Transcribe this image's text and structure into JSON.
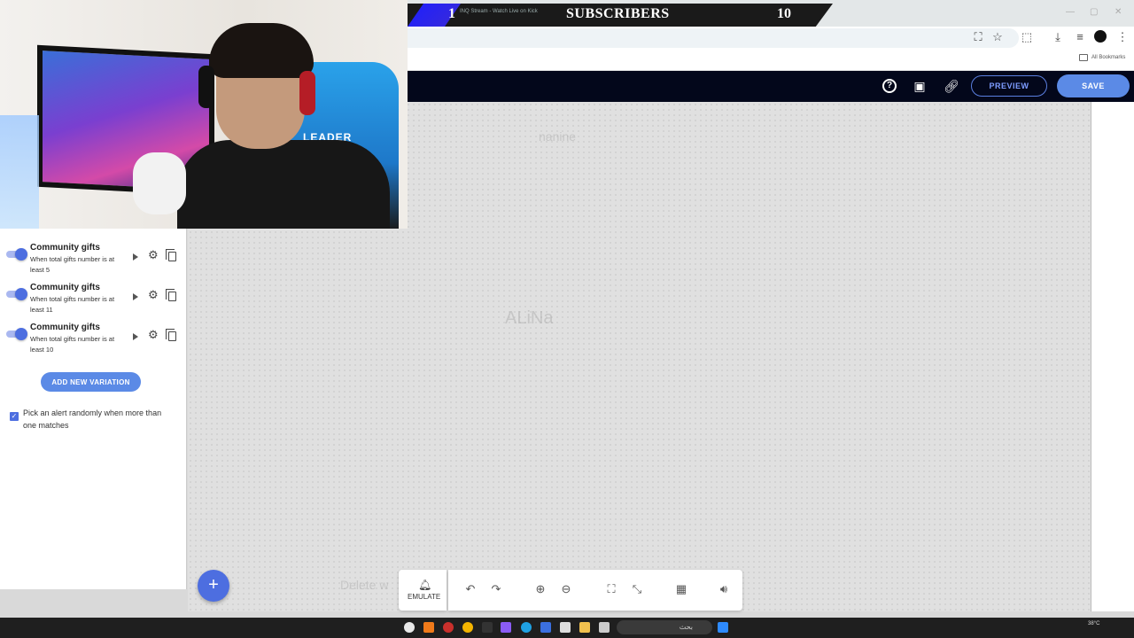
{
  "overlay": {
    "sub_count_left": "1",
    "tab_text": "INQ Stream - Watch Live on Kick",
    "subscribers_label": "SUBSCRIBERS",
    "sub_count_right": "10",
    "chair_text": "LEADER"
  },
  "browser": {
    "bookmarks_label": "All Bookmarks"
  },
  "editor": {
    "preview_label": "PREVIEW",
    "save_label": "SAVE",
    "ghost_name": "nanine",
    "ghost_alert": "ALiNa",
    "ghost_delete": "Delete w"
  },
  "variations": [
    {
      "title": "Community gifts",
      "desc": "When total gifts number is at least 5"
    },
    {
      "title": "Community gifts",
      "desc": "When total gifts number is at least 11"
    },
    {
      "title": "Community gifts",
      "desc": "When total gifts number is at least 10"
    }
  ],
  "panel": {
    "add_variation_label": "ADD NEW VARIATION",
    "random_label": "Pick an alert randomly when more than one matches"
  },
  "toolbar": {
    "emulate_label": "EMULATE"
  },
  "taskbar": {
    "search_text": "بحث",
    "weather": "38°C"
  },
  "colors": {
    "accent": "#5b8ae6",
    "header_bg": "#03071b",
    "toggle_on": "#4d6ee0"
  }
}
